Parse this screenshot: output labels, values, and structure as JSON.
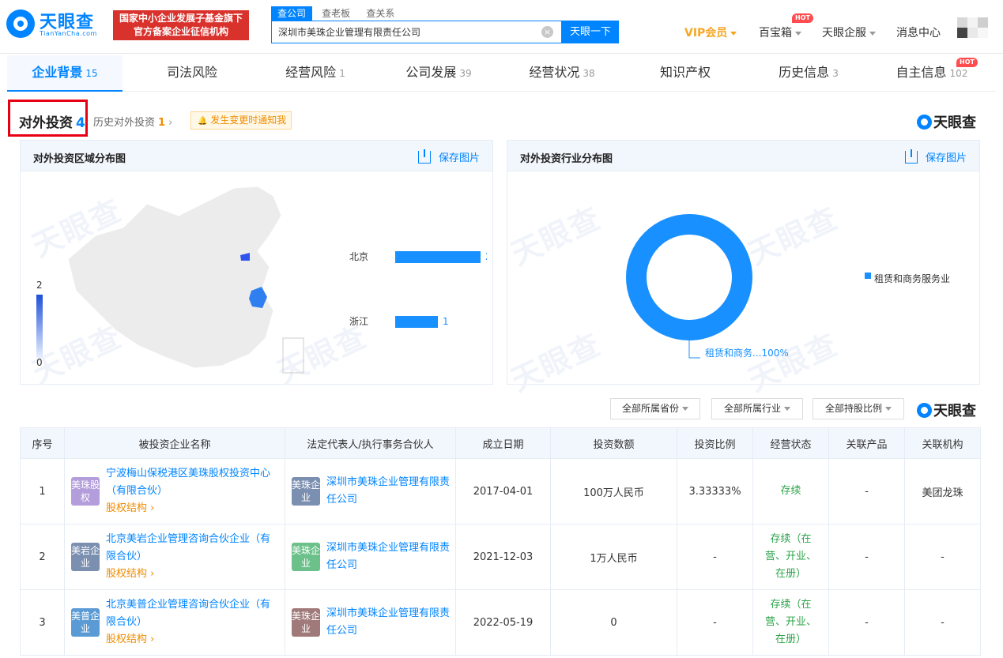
{
  "header": {
    "logo_text": "天眼查",
    "logo_sub": "TianYanCha.com",
    "badge_line1": "国家中小企业发展子基金旗下",
    "badge_line2": "官方备案企业征信机构",
    "search_tabs": [
      "查公司",
      "查老板",
      "查关系"
    ],
    "search_value": "深圳市美珠企业管理有限责任公司",
    "search_button": "天眼一下",
    "vip": "VIP会员",
    "baibaoxiang": "百宝箱",
    "hot": "HOT",
    "enterprise_service": "天眼企服",
    "messages": "消息中心"
  },
  "tabs": [
    {
      "label": "企业背景",
      "count": "15"
    },
    {
      "label": "司法风险",
      "count": ""
    },
    {
      "label": "经营风险",
      "count": "1"
    },
    {
      "label": "公司发展",
      "count": "39"
    },
    {
      "label": "经营状况",
      "count": "38"
    },
    {
      "label": "知识产权",
      "count": ""
    },
    {
      "label": "历史信息",
      "count": "3"
    },
    {
      "label": "自主信息",
      "count": "102"
    }
  ],
  "section": {
    "title": "对外投资",
    "count": "4",
    "history_label": "历史对外投资",
    "history_count": "1",
    "notify": "发生变更时通知我",
    "brand": "天眼查"
  },
  "region_panel": {
    "title": "对外投资区域分布图",
    "save": "保存图片",
    "watermark": "天眼查",
    "legend_max": "2",
    "legend_min": "0"
  },
  "industry_panel": {
    "title": "对外投资行业分布图",
    "save": "保存图片",
    "watermark": "天眼查",
    "legend_item": "租赁和商务服务业",
    "slice_label": "租赁和商务...100%"
  },
  "chart_data": [
    {
      "type": "bar",
      "orientation": "horizontal",
      "categories": [
        "北京",
        "浙江"
      ],
      "values": [
        2,
        1
      ]
    },
    {
      "type": "pie",
      "labels": [
        "租赁和商务服务业"
      ],
      "values": [
        100
      ],
      "donut": true,
      "legend": "right",
      "color": "#1890ff"
    }
  ],
  "filters": [
    "全部所属省份",
    "全部所属行业",
    "全部持股比例"
  ],
  "table": {
    "headers": [
      "序号",
      "被投资企业名称",
      "法定代表人/执行事务合伙人",
      "成立日期",
      "投资数额",
      "投资比例",
      "经营状态",
      "关联产品",
      "关联机构"
    ],
    "rows": [
      {
        "no": "1",
        "avatar": "美珠股权",
        "avatar_color": "#b39ddb",
        "name": "宁波梅山保税港区美珠股权投资中心（有限合伙）",
        "link": "股权结构",
        "rep_avatar": "美珠企业",
        "rep_avatar_color": "#7b8fb0",
        "rep": "深圳市美珠企业管理有限责任公司",
        "date": "2017-04-01",
        "amount": "100万人民币",
        "ratio": "3.33333%",
        "status": "存续",
        "product": "-",
        "org": "美团龙珠"
      },
      {
        "no": "2",
        "avatar": "美岩企业",
        "avatar_color": "#7b8fb0",
        "name": "北京美岩企业管理咨询合伙企业（有限合伙）",
        "link": "股权结构",
        "rep_avatar": "美珠企业",
        "rep_avatar_color": "#6cc08a",
        "rep": "深圳市美珠企业管理有限责任公司",
        "date": "2021-12-03",
        "amount": "1万人民币",
        "ratio": "-",
        "status": "存续（在营、开业、在册）",
        "product": "-",
        "org": "-"
      },
      {
        "no": "3",
        "avatar": "美普企业",
        "avatar_color": "#5b9bd5",
        "name": "北京美普企业管理咨询合伙企业（有限合伙）",
        "link": "股权结构",
        "rep_avatar": "美珠企业",
        "rep_avatar_color": "#a07a7a",
        "rep": "深圳市美珠企业管理有限责任公司",
        "date": "2022-05-19",
        "amount": "0",
        "ratio": "-",
        "status": "存续（在营、开业、在册）",
        "product": "-",
        "org": "-"
      }
    ]
  }
}
